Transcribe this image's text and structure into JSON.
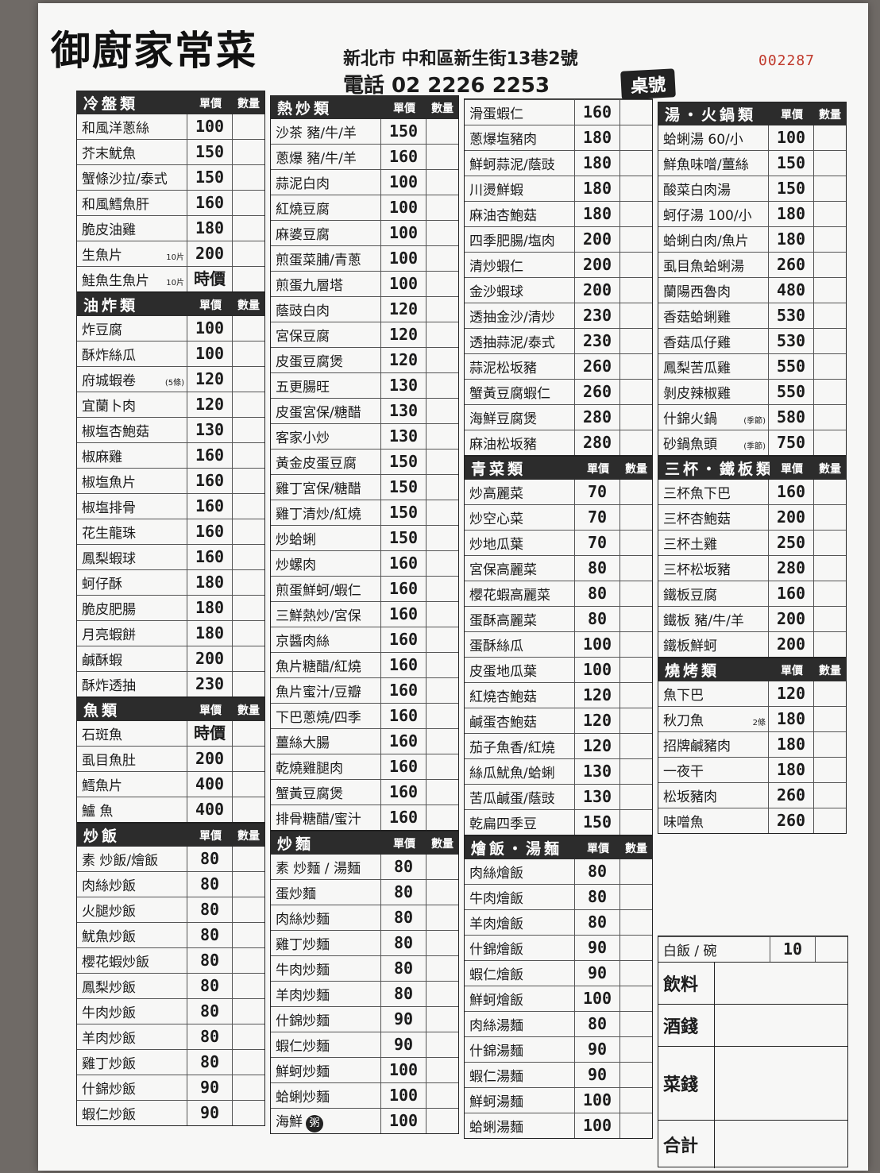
{
  "header": {
    "brand": "御廚家常菜",
    "address": "新北市 中和區新生街13巷2號",
    "phone": "電話 02 2226 2253",
    "serial": "002287",
    "table_label": "桌號"
  },
  "columns": [
    [
      {
        "title": "冷盤類",
        "price_label": "單價",
        "qty_label": "數量",
        "items": [
          {
            "name": "和風洋蔥絲",
            "price": "100"
          },
          {
            "name": "芥末魷魚",
            "price": "150"
          },
          {
            "name": "蟹條沙拉/泰式",
            "price": "150"
          },
          {
            "name": "和風鱈魚肝",
            "price": "160"
          },
          {
            "name": "脆皮油雞",
            "price": "180"
          },
          {
            "name": "生魚片",
            "note": "10片",
            "price": "200"
          },
          {
            "name": "鮭魚生魚片",
            "note": "10片",
            "price": "時價"
          }
        ]
      },
      {
        "title": "油炸類",
        "price_label": "單價",
        "qty_label": "數量",
        "items": [
          {
            "name": "炸豆腐",
            "price": "100"
          },
          {
            "name": "酥炸絲瓜",
            "price": "100"
          },
          {
            "name": "府城蝦卷",
            "note": "(5條)",
            "price": "120"
          },
          {
            "name": "宜蘭卜肉",
            "price": "120"
          },
          {
            "name": "椒塩杏鮑菇",
            "price": "130"
          },
          {
            "name": "椒麻雞",
            "price": "160"
          },
          {
            "name": "椒塩魚片",
            "price": "160"
          },
          {
            "name": "椒塩排骨",
            "price": "160"
          },
          {
            "name": "花生龍珠",
            "price": "160"
          },
          {
            "name": "鳳梨蝦球",
            "price": "160"
          },
          {
            "name": "蚵仔酥",
            "price": "180"
          },
          {
            "name": "脆皮肥腸",
            "price": "180"
          },
          {
            "name": "月亮蝦餅",
            "price": "180"
          },
          {
            "name": "鹹酥蝦",
            "price": "200"
          },
          {
            "name": "酥炸透抽",
            "price": "230"
          }
        ]
      },
      {
        "title": "魚類",
        "price_label": "單價",
        "qty_label": "數量",
        "items": [
          {
            "name": "石斑魚",
            "price": "時價"
          },
          {
            "name": "虱目魚肚",
            "price": "200"
          },
          {
            "name": "鱈魚片",
            "price": "400"
          },
          {
            "name": "鱸 魚",
            "price": "400"
          }
        ]
      },
      {
        "title": "炒飯",
        "price_label": "單價",
        "qty_label": "數量",
        "items": [
          {
            "name": "素 炒飯/燴飯",
            "price": "80"
          },
          {
            "name": "肉絲炒飯",
            "price": "80"
          },
          {
            "name": "火腿炒飯",
            "price": "80"
          },
          {
            "name": "魷魚炒飯",
            "price": "80"
          },
          {
            "name": "櫻花蝦炒飯",
            "price": "80"
          },
          {
            "name": "鳳梨炒飯",
            "price": "80"
          },
          {
            "name": "牛肉炒飯",
            "price": "80"
          },
          {
            "name": "羊肉炒飯",
            "price": "80"
          },
          {
            "name": "雞丁炒飯",
            "price": "80"
          },
          {
            "name": "什錦炒飯",
            "price": "90"
          },
          {
            "name": "蝦仁炒飯",
            "price": "90"
          }
        ]
      }
    ],
    [
      {
        "title": "熱炒類",
        "price_label": "單價",
        "qty_label": "數量",
        "items": [
          {
            "name": "沙茶 豬/牛/羊",
            "price": "150"
          },
          {
            "name": "蔥爆 豬/牛/羊",
            "price": "160"
          },
          {
            "name": "蒜泥白肉",
            "price": "100"
          },
          {
            "name": "紅燒豆腐",
            "price": "100"
          },
          {
            "name": "麻婆豆腐",
            "price": "100"
          },
          {
            "name": "煎蛋菜脯/青蔥",
            "price": "100"
          },
          {
            "name": "煎蛋九層塔",
            "price": "100"
          },
          {
            "name": "蔭豉白肉",
            "price": "120"
          },
          {
            "name": "宮保豆腐",
            "price": "120"
          },
          {
            "name": "皮蛋豆腐煲",
            "price": "120"
          },
          {
            "name": "五更腸旺",
            "price": "130"
          },
          {
            "name": "皮蛋宮保/糖醋",
            "price": "130"
          },
          {
            "name": "客家小炒",
            "price": "130"
          },
          {
            "name": "黃金皮蛋豆腐",
            "price": "150"
          },
          {
            "name": "雞丁宮保/糖醋",
            "price": "150"
          },
          {
            "name": "雞丁清炒/紅燒",
            "price": "150"
          },
          {
            "name": "炒蛤蜊",
            "price": "150"
          },
          {
            "name": "炒螺肉",
            "price": "160"
          },
          {
            "name": "煎蛋鮮蚵/蝦仁",
            "price": "160"
          },
          {
            "name": "三鮮熱炒/宮保",
            "price": "160"
          },
          {
            "name": "京醬肉絲",
            "price": "160"
          },
          {
            "name": "魚片糖醋/紅燒",
            "price": "160"
          },
          {
            "name": "魚片蜜汁/豆瓣",
            "price": "160"
          },
          {
            "name": "下巴蔥燒/四季",
            "price": "160"
          },
          {
            "name": "薑絲大腸",
            "price": "160"
          },
          {
            "name": "乾燒雞腿肉",
            "price": "160"
          },
          {
            "name": "蟹黃豆腐煲",
            "price": "160"
          },
          {
            "name": "排骨糖醋/蜜汁",
            "price": "160"
          }
        ]
      },
      {
        "title": "炒麵",
        "price_label": "單價",
        "qty_label": "數量",
        "items": [
          {
            "name": "素 炒麵 / 湯麵",
            "price": "80"
          },
          {
            "name": "蛋炒麵",
            "price": "80"
          },
          {
            "name": "肉絲炒麵",
            "price": "80"
          },
          {
            "name": "雞丁炒麵",
            "price": "80"
          },
          {
            "name": "牛肉炒麵",
            "price": "80"
          },
          {
            "name": "羊肉炒麵",
            "price": "80"
          },
          {
            "name": "什錦炒麵",
            "price": "90"
          },
          {
            "name": "蝦仁炒麵",
            "price": "90"
          },
          {
            "name": "鮮蚵炒麵",
            "price": "100"
          },
          {
            "name": "蛤蜊炒麵",
            "price": "100"
          },
          {
            "name": "海鮮",
            "badge": "粥",
            "price": "100"
          }
        ]
      }
    ],
    [
      {
        "title": "",
        "price_label": "",
        "qty_label": "",
        "items": [
          {
            "name": "滑蛋蝦仁",
            "price": "160"
          },
          {
            "name": "蔥爆塩豬肉",
            "price": "180"
          },
          {
            "name": "鮮蚵蒜泥/蔭豉",
            "price": "180"
          },
          {
            "name": "川燙鮮蝦",
            "price": "180"
          },
          {
            "name": "麻油杏鮑菇",
            "price": "180"
          },
          {
            "name": "四季肥腸/塩肉",
            "price": "200"
          },
          {
            "name": "清炒蝦仁",
            "price": "200"
          },
          {
            "name": "金沙蝦球",
            "price": "200"
          },
          {
            "name": "透抽金沙/清炒",
            "price": "230"
          },
          {
            "name": "透抽蒜泥/泰式",
            "price": "230"
          },
          {
            "name": "蒜泥松坂豬",
            "price": "260"
          },
          {
            "name": "蟹黃豆腐蝦仁",
            "price": "260"
          },
          {
            "name": "海鮮豆腐煲",
            "price": "280"
          },
          {
            "name": "麻油松坂豬",
            "price": "280"
          }
        ]
      },
      {
        "title": "青菜類",
        "price_label": "單價",
        "qty_label": "數量",
        "items": [
          {
            "name": "炒高麗菜",
            "price": "70"
          },
          {
            "name": "炒空心菜",
            "price": "70"
          },
          {
            "name": "炒地瓜葉",
            "price": "70"
          },
          {
            "name": "宮保高麗菜",
            "price": "80"
          },
          {
            "name": "櫻花蝦高麗菜",
            "price": "80"
          },
          {
            "name": "蛋酥高麗菜",
            "price": "80"
          },
          {
            "name": "蛋酥絲瓜",
            "price": "100"
          },
          {
            "name": "皮蛋地瓜葉",
            "price": "100"
          },
          {
            "name": "紅燒杏鮑菇",
            "price": "120"
          },
          {
            "name": "鹹蛋杏鮑菇",
            "price": "120"
          },
          {
            "name": "茄子魚香/紅燒",
            "price": "120"
          },
          {
            "name": "絲瓜魷魚/蛤蜊",
            "price": "130"
          },
          {
            "name": "苦瓜鹹蛋/蔭豉",
            "price": "130"
          },
          {
            "name": "乾扁四季豆",
            "price": "150"
          }
        ]
      },
      {
        "title": "燴飯・湯麵",
        "price_label": "單價",
        "qty_label": "數量",
        "items": [
          {
            "name": "肉絲燴飯",
            "price": "80"
          },
          {
            "name": "牛肉燴飯",
            "price": "80"
          },
          {
            "name": "羊肉燴飯",
            "price": "80"
          },
          {
            "name": "什錦燴飯",
            "price": "90"
          },
          {
            "name": "蝦仁燴飯",
            "price": "90"
          },
          {
            "name": "鮮蚵燴飯",
            "price": "100"
          },
          {
            "name": "肉絲湯麵",
            "price": "80"
          },
          {
            "name": "什錦湯麵",
            "price": "90"
          },
          {
            "name": "蝦仁湯麵",
            "price": "90"
          },
          {
            "name": "鮮蚵湯麵",
            "price": "100"
          },
          {
            "name": "蛤蜊湯麵",
            "price": "100"
          }
        ]
      }
    ],
    [
      {
        "title": "湯・火鍋類",
        "price_label": "單價",
        "qty_label": "數量",
        "items": [
          {
            "name": "蛤蜊湯 60/小",
            "price": "100"
          },
          {
            "name": "鮮魚味噌/薑絲",
            "price": "150"
          },
          {
            "name": "酸菜白肉湯",
            "price": "150"
          },
          {
            "name": "蚵仔湯 100/小",
            "price": "180"
          },
          {
            "name": "蛤蜊白肉/魚片",
            "price": "180"
          },
          {
            "name": "虱目魚蛤蜊湯",
            "price": "260"
          },
          {
            "name": "蘭陽西魯肉",
            "price": "480"
          },
          {
            "name": "香菇蛤蜊雞",
            "price": "530"
          },
          {
            "name": "香菇瓜仔雞",
            "price": "530"
          },
          {
            "name": "鳳梨苦瓜雞",
            "price": "550"
          },
          {
            "name": "剝皮辣椒雞",
            "price": "550"
          },
          {
            "name": "什錦火鍋",
            "note": "(季節)",
            "price": "580"
          },
          {
            "name": "砂鍋魚頭",
            "note": "(季節)",
            "price": "750"
          }
        ]
      },
      {
        "title": "三杯・鐵板類",
        "price_label": "單價",
        "qty_label": "數量",
        "items": [
          {
            "name": "三杯魚下巴",
            "price": "160"
          },
          {
            "name": "三杯杏鮑菇",
            "price": "200"
          },
          {
            "name": "三杯土雞",
            "price": "250"
          },
          {
            "name": "三杯松坂豬",
            "price": "280"
          },
          {
            "name": "鐵板豆腐",
            "price": "160"
          },
          {
            "name": "鐵板 豬/牛/羊",
            "price": "200"
          },
          {
            "name": "鐵板鮮蚵",
            "price": "200"
          }
        ]
      },
      {
        "title": "燒烤類",
        "price_label": "單價",
        "qty_label": "數量",
        "items": [
          {
            "name": "魚下巴",
            "price": "120"
          },
          {
            "name": "秋刀魚",
            "note": "2條",
            "price": "180"
          },
          {
            "name": "招牌鹹豬肉",
            "price": "180"
          },
          {
            "name": "一夜干",
            "price": "180"
          },
          {
            "name": "松坂豬肉",
            "price": "260"
          },
          {
            "name": "味噌魚",
            "price": "260"
          }
        ]
      }
    ]
  ],
  "rice": {
    "name": "白飯 / 碗",
    "price": "10"
  },
  "totals": {
    "drinks": "飲料",
    "alcohol": "酒錢",
    "food": "菜錢",
    "total": "合計"
  }
}
